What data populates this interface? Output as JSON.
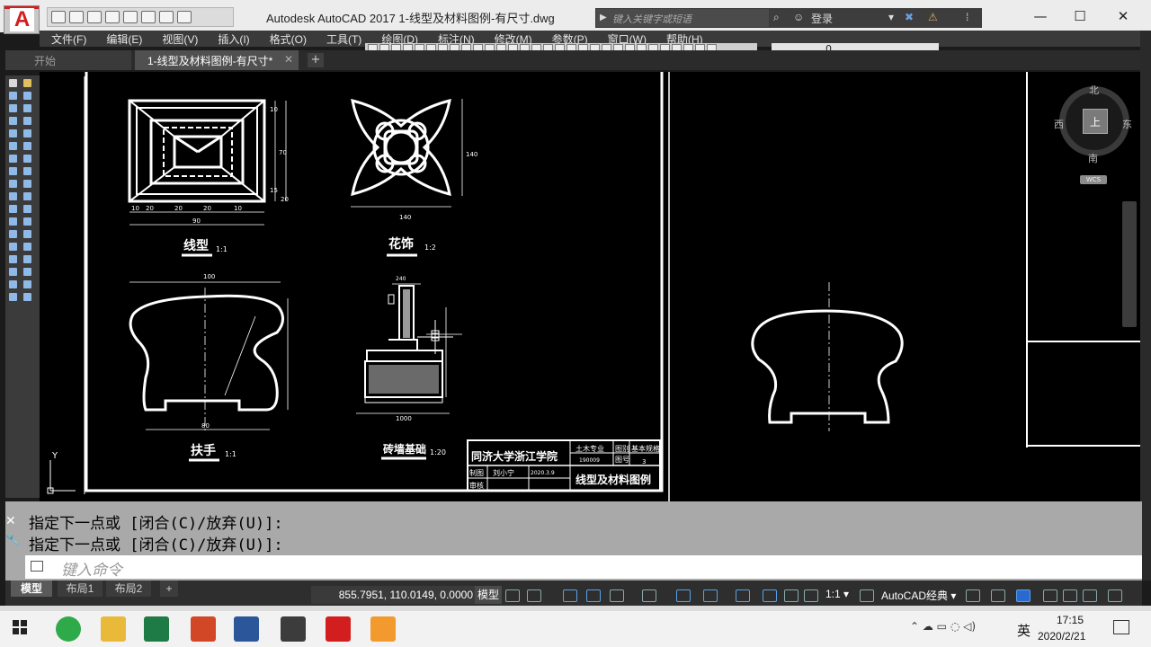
{
  "app": {
    "window_title": "Autodesk AutoCAD 2017     1-线型及材料图例-有尺寸.dwg",
    "search_placeholder": "键入关键字或短语",
    "login_label": "登录",
    "win_min": "—",
    "win_max": "☐",
    "win_close": "✕"
  },
  "menu": [
    "文件(F)",
    "编辑(E)",
    "视图(V)",
    "插入(I)",
    "格式(O)",
    "工具(T)",
    "绘图(D)",
    "标注(N)",
    "修改(M)",
    "参数(P)",
    "窗口(W)",
    "帮助(H)"
  ],
  "tabs": {
    "start": "开始",
    "drawing": "1-线型及材料图例-有尺寸*",
    "close": "✕",
    "add": "+"
  },
  "layer": {
    "name": "0"
  },
  "drawing": {
    "title_line": "线型",
    "title_line_scale": "1:1",
    "title_flower": "花饰",
    "title_flower_scale": "1:2",
    "title_handrail": "扶手",
    "title_handrail_scale": "1:1",
    "title_foundation": "砖墙基础",
    "title_foundation_scale": "1:20",
    "dims_line": [
      "10",
      "20",
      "20",
      "20",
      "10",
      "90"
    ],
    "dims_line_v": [
      "10",
      "70",
      "15",
      "20"
    ],
    "dim_flower_w": "140",
    "dim_flower_h": "140",
    "dim_handrail_w": "100",
    "dim_handrail_b": "80",
    "dim_foundation_w": "1000",
    "dim_foundation_top": "240",
    "titleblock": {
      "school": "同济大学浙江学院",
      "major": "土木专业",
      "id": "190009",
      "r1": "图别",
      "r1v": "基本规格",
      "r2": "图号",
      "r2v": "3",
      "drawn_by_label": "制图",
      "drawn_by": "刘小宁",
      "date": "2020.3.9",
      "check_label": "审核",
      "drawing_name": "线型及材料图例"
    },
    "ucs_y": "Y"
  },
  "viewcube": {
    "north": "北",
    "south": "南",
    "east": "东",
    "west": "西",
    "face": "上",
    "wcs": "WCS"
  },
  "command": {
    "history": [
      "指定下一点或 [闭合(C)/放弃(U)]:",
      "指定下一点或 [闭合(C)/放弃(U)]:"
    ],
    "placeholder": "键入命令"
  },
  "layout_tabs": [
    "模型",
    "布局1",
    "布局2",
    "+"
  ],
  "status": {
    "coords": "855.7951, 110.0149, 0.0000",
    "model": "模型",
    "scale": "1:1 ▾",
    "workspace": "AutoCAD经典 ▾"
  },
  "taskbar": {
    "time": "17:15",
    "date": "2020/2/21",
    "ime": "英"
  },
  "colors": {
    "accent": "#d21e1e",
    "canvas": "#000000",
    "line": "#ffffff"
  }
}
